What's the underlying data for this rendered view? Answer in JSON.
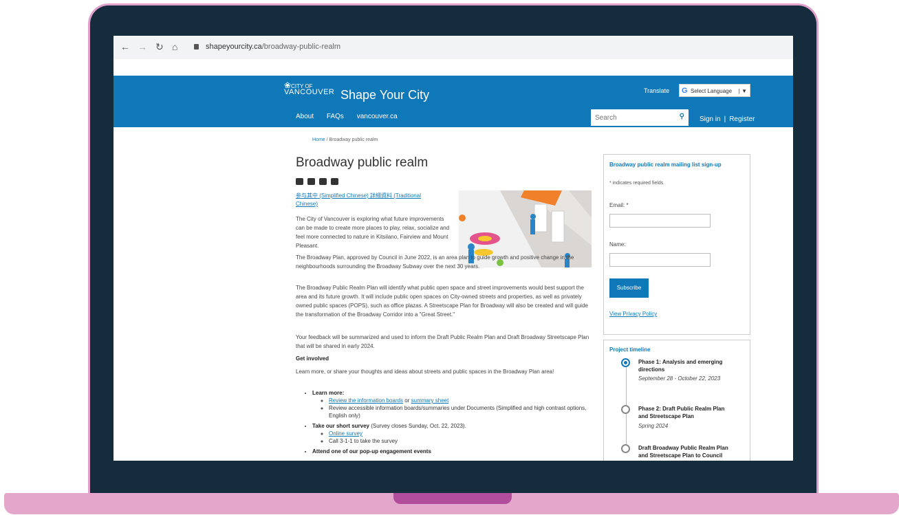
{
  "browser": {
    "url_domain": "shapeyourcity.ca",
    "url_path": "/broadway-public-realm",
    "back_icon": "arrow-left",
    "forward_icon": "arrow-right",
    "reload_icon": "reload",
    "home_icon": "home"
  },
  "header": {
    "logo_small": "CITY OF",
    "logo_main": "VANCOUVER",
    "title": "Shape Your City",
    "translate": "Translate",
    "language_select": "Select Language",
    "nav": [
      "About",
      "FAQs",
      "vancouver.ca"
    ],
    "search_placeholder": "Search",
    "signin": "Sign in",
    "register": "Register"
  },
  "breadcrumb": {
    "home": "Home",
    "sep": "/",
    "current": "Broadway public realm"
  },
  "page_title": "Broadway public realm",
  "lang_link": "参与其中 (Simplified Chinese) 詳細資料 (Traditional Chinese)",
  "paragraphs": [
    "The City of Vancouver is exploring what future improvements can be made to create more places to play, relax, socialize and feel more connected to nature in Kitsilano, Fairview and Mount Pleasant.",
    "The Broadway Plan, approved by Council in June 2022, is an area plan to guide growth and positive change in the neighbourhoods surrounding the Broadway Subway over the next 30 years.",
    "The Broadway Public Realm Plan will identify what public open space and street improvements would best support the area and its future growth. It will include public open spaces on City-owned streets and properties, as well as privately owned public spaces (POPS), such as office plazas. A Streetscape Plan for Broadway will also be created and will guide the transformation of the Broadway Corridor into a \"Great Street.\"",
    "Your feedback will be summarized and used to inform the Draft Public Realm Plan and Draft Broadway Streetscape Plan that will be shared in early 2024."
  ],
  "get_involved": {
    "heading": "Get involved",
    "intro": "Learn more, or share your thoughts and ideas about streets and public spaces in the Broadway Plan area!",
    "learn_more": "Learn more:",
    "review_boards": "Review the information boards",
    "or": " or ",
    "summary_sheet": "summary sheet",
    "accessible": "Review accessible information boards/summaries under Documents (Simplified and high contrast options, English only)",
    "survey_bold": "Take our short survey",
    "survey_rest": " (Survey closes Sunday, Oct. 22, 2023).",
    "online_survey": "Online survey",
    "call": "Call 3-1-1 to take the survey",
    "events": "Attend one of our pop-up engagement events"
  },
  "mailing": {
    "title": "Broadway public realm mailing list sign-up",
    "required_note": "* indicates required fields",
    "email_label": "Email: *",
    "name_label": "Name:",
    "subscribe": "Subscribe",
    "privacy": "View Privacy Policy"
  },
  "timeline": {
    "title": "Project timeline",
    "phases": [
      {
        "name": "Phase 1: Analysis and emerging directions",
        "date": "September 28 - October 22, 2023",
        "active": true
      },
      {
        "name": "Phase 2: Draft Public Realm Plan and Streetscape Plan",
        "date": "Spring 2024",
        "active": false
      },
      {
        "name": "Draft Broadway Public Realm Plan and Streetscape Plan to Council",
        "date": "",
        "active": false
      }
    ]
  },
  "colors": {
    "brand_blue": "#0f78b8",
    "laptop_frame": "#142c3c",
    "laptop_base": "#e3a7cc"
  }
}
